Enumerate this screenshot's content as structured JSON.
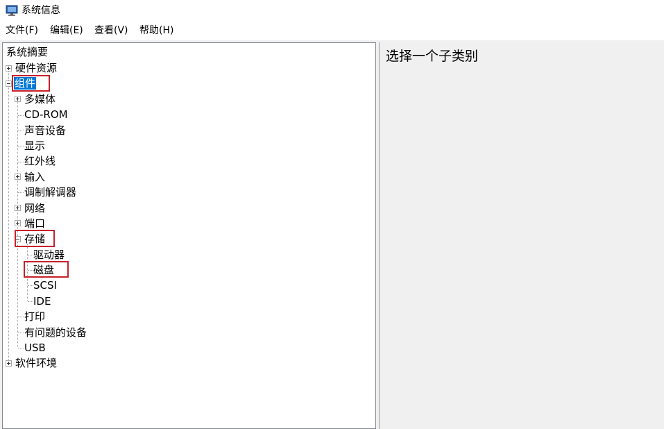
{
  "window": {
    "title": "系统信息",
    "icon": "system-info-monitor-icon"
  },
  "menubar": {
    "items": [
      {
        "label": "文件(F)"
      },
      {
        "label": "编辑(E)"
      },
      {
        "label": "查看(V)"
      },
      {
        "label": "帮助(H)"
      }
    ]
  },
  "tree": {
    "root": "系统摘要",
    "hardware": "硬件资源",
    "components": "组件",
    "multimedia": "多媒体",
    "cdrom": "CD-ROM",
    "sound": "声音设备",
    "display": "显示",
    "infrared": "红外线",
    "input": "输入",
    "modem": "调制解调器",
    "network": "网络",
    "ports": "端口",
    "storage": "存储",
    "drives": "驱动器",
    "disks": "磁盘",
    "scsi": "SCSI",
    "ide": "IDE",
    "printing": "打印",
    "problem_devices": "有问题的设备",
    "usb": "USB",
    "software": "软件环境"
  },
  "detail": {
    "prompt": "选择一个子类别"
  },
  "colors": {
    "selection": "#0078d7",
    "highlight_box": "#c8202a",
    "pane_background": "#f0f0f0"
  }
}
